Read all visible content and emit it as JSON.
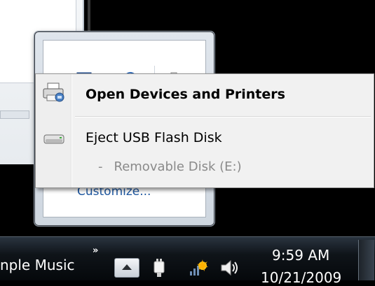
{
  "context_menu": {
    "open_devices_label": "Open Devices and Printers",
    "eject_label": "Eject USB Flash Disk",
    "sub_dash": "-",
    "sub_label": "Removable Disk (E:)"
  },
  "flyout": {
    "customize_label": "Customize..."
  },
  "taskbar": {
    "app_label": "nple Music",
    "overflow_chevrons": "»",
    "clock_time": "9:59 AM",
    "clock_date": "10/21/2009"
  },
  "icons": {
    "printer": "printer-icon",
    "drive": "usb-drive-icon",
    "bluetooth": "bluetooth-icon",
    "power": "power-plug-icon",
    "network": "network-icon",
    "volume": "volume-icon",
    "show_hidden": "up-arrow-icon"
  },
  "colors": {
    "link": "#1e57a0",
    "menu_bg": "#f1f1f1",
    "taskbar": "#0f1419"
  }
}
